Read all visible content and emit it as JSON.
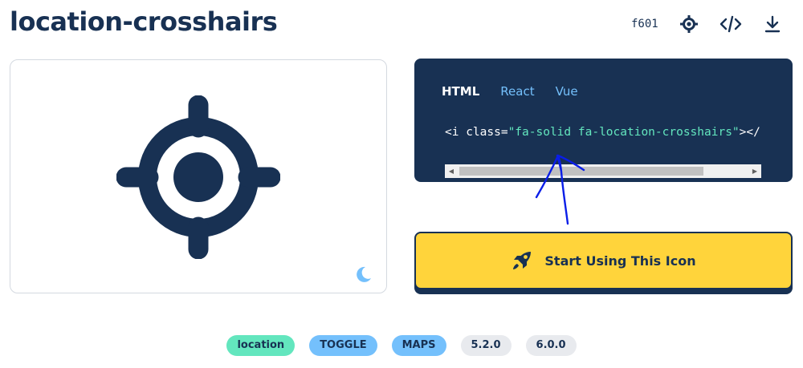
{
  "icon": {
    "name": "location-crosshairs",
    "unicode": "f601"
  },
  "toolbar": {
    "icons": [
      "crosshairs-icon",
      "code-icon",
      "download-icon"
    ]
  },
  "code": {
    "tabs": [
      {
        "label": "HTML",
        "active": true
      },
      {
        "label": "React",
        "active": false
      },
      {
        "label": "Vue",
        "active": false
      }
    ],
    "prefix": "<i class=",
    "string": "\"fa-solid fa-location-crosshairs\"",
    "suffix": "></i>"
  },
  "cta": {
    "label": "Start Using This Icon",
    "icon": "rocket-icon"
  },
  "tags": [
    {
      "label": "location",
      "color": "#63e6be"
    },
    {
      "label": "TOGGLE",
      "color": "#74c0fc"
    },
    {
      "label": "MAPS",
      "color": "#74c0fc"
    },
    {
      "label": "5.2.0",
      "color": "#e8eaee"
    },
    {
      "label": "6.0.0",
      "color": "#e8eaee"
    }
  ],
  "colors": {
    "navy": "#183153",
    "yellow": "#ffd43b",
    "teal": "#63e6be",
    "sky": "#74c0fc",
    "annotation": "#0a1ee8"
  }
}
